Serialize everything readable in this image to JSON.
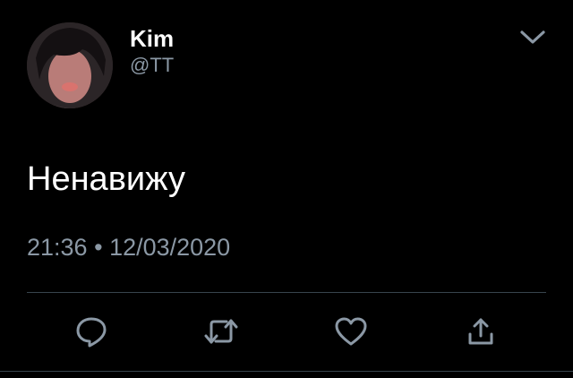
{
  "user": {
    "display_name": "Kim",
    "handle": "@TT",
    "avatar": "profile-photo"
  },
  "tweet": {
    "text": "Ненавижу",
    "time": "21:36",
    "separator": "•",
    "date": "12/03/2020"
  },
  "actions": {
    "reply_icon": "reply-icon",
    "retweet_icon": "retweet-icon",
    "like_icon": "like-icon",
    "share_icon": "share-icon",
    "menu_icon": "chevron-down-icon"
  },
  "colors": {
    "background": "#000000",
    "text": "#ffffff",
    "secondary": "#8b98a5",
    "divider": "#38444d",
    "icon": "#8b98a5"
  }
}
